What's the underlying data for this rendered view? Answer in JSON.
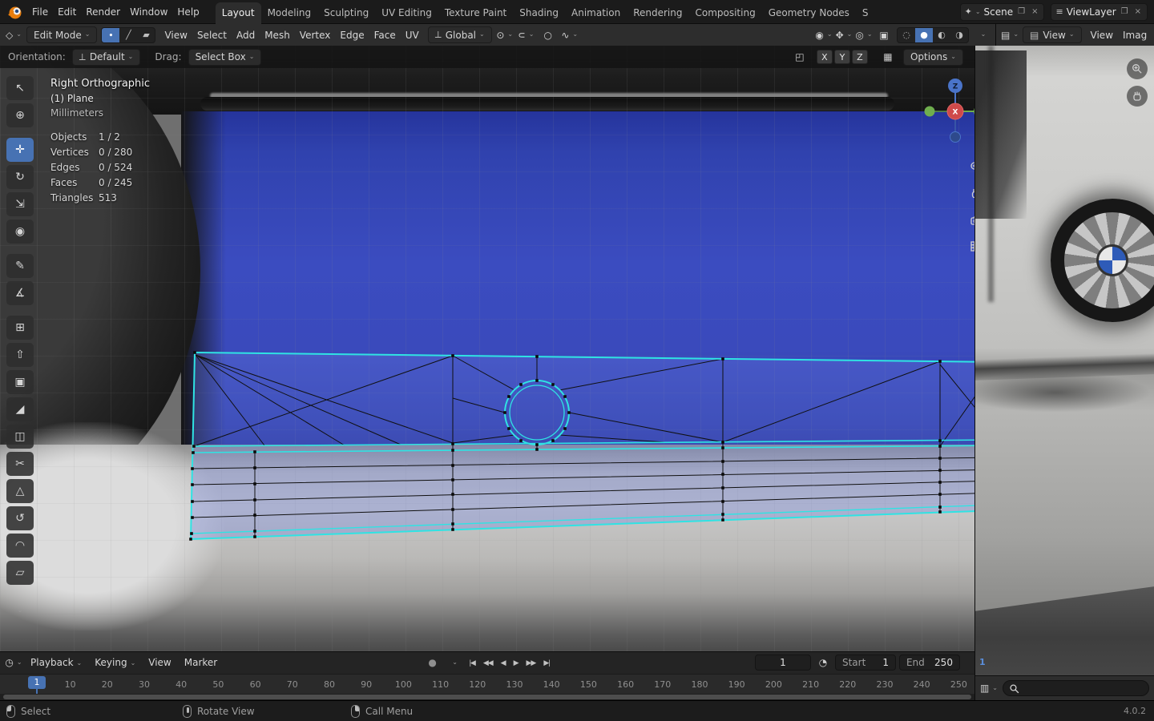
{
  "topbar": {
    "menus": [
      "File",
      "Edit",
      "Render",
      "Window",
      "Help"
    ],
    "workspaces": [
      {
        "label": "Layout",
        "active": true
      },
      {
        "label": "Modeling"
      },
      {
        "label": "Sculpting"
      },
      {
        "label": "UV Editing"
      },
      {
        "label": "Texture Paint"
      },
      {
        "label": "Shading"
      },
      {
        "label": "Animation"
      },
      {
        "label": "Rendering"
      },
      {
        "label": "Compositing"
      },
      {
        "label": "Geometry Nodes"
      },
      {
        "label": "S"
      }
    ],
    "scene_label": "Scene",
    "view_layer_label": "ViewLayer"
  },
  "viewport_header": {
    "mode": "Edit Mode",
    "select_modes": [
      {
        "name": "vertex-select",
        "glyph": "∙",
        "active": true
      },
      {
        "name": "edge-select",
        "glyph": "╱"
      },
      {
        "name": "face-select",
        "glyph": "▰"
      }
    ],
    "menus": [
      "View",
      "Select",
      "Add",
      "Mesh",
      "Vertex",
      "Edge",
      "Face",
      "UV"
    ],
    "orientation": "Global",
    "toggles": [
      {
        "name": "visibility",
        "glyph": "◉",
        "dd": true
      },
      {
        "name": "gizmos",
        "glyph": "✥",
        "dd": true
      },
      {
        "name": "overlays",
        "glyph": "◎",
        "dd": true
      },
      {
        "name": "xray",
        "glyph": "▣"
      }
    ],
    "shading_modes": [
      {
        "name": "wireframe",
        "glyph": "◌"
      },
      {
        "name": "solid",
        "glyph": "●",
        "active": true
      },
      {
        "name": "material-preview",
        "glyph": "◐"
      },
      {
        "name": "rendered",
        "glyph": "◑"
      }
    ]
  },
  "image_header": {
    "mode": "View",
    "menus": [
      "View",
      "Imag"
    ]
  },
  "tool_settings": {
    "orientation_label": "Orientation:",
    "orientation_value": "Default",
    "drag_label": "Drag:",
    "drag_value": "Select Box",
    "axes": [
      "X",
      "Y",
      "Z"
    ],
    "options_label": "Options"
  },
  "toolbar": {
    "tools": [
      {
        "name": "tweak-select",
        "glyph": "↖"
      },
      {
        "name": "cursor",
        "glyph": "⊕"
      },
      {
        "name": "move",
        "glyph": "✛",
        "active": true,
        "gap": true
      },
      {
        "name": "rotate",
        "glyph": "↻"
      },
      {
        "name": "scale",
        "glyph": "⇲"
      },
      {
        "name": "transform",
        "glyph": "◉"
      },
      {
        "name": "annotate",
        "glyph": "✎",
        "gap": true
      },
      {
        "name": "measure",
        "glyph": "∡"
      },
      {
        "name": "add-cube",
        "glyph": "⊞",
        "gap": true
      },
      {
        "name": "extrude-region",
        "glyph": "⇧"
      },
      {
        "name": "inset-faces",
        "glyph": "▣"
      },
      {
        "name": "bevel",
        "glyph": "◢"
      },
      {
        "name": "loop-cut",
        "glyph": "◫"
      },
      {
        "name": "knife",
        "glyph": "✂"
      },
      {
        "name": "poly-build",
        "glyph": "△"
      },
      {
        "name": "spin",
        "glyph": "↺"
      },
      {
        "name": "smooth",
        "glyph": "◠"
      },
      {
        "name": "edge-slide",
        "glyph": "▱"
      }
    ]
  },
  "viewport": {
    "view_label": "Right Orthographic",
    "object_label": "(1) Plane",
    "units_label": "Millimeters",
    "stats": [
      {
        "label": "Objects",
        "value": "1 / 2"
      },
      {
        "label": "Vertices",
        "value": "0 / 280"
      },
      {
        "label": "Edges",
        "value": "0 / 524"
      },
      {
        "label": "Faces",
        "value": "0 / 245"
      },
      {
        "label": "Triangles",
        "value": "513"
      }
    ],
    "gizmo": {
      "x": "X",
      "y": "Y",
      "z": "Z"
    }
  },
  "timeline": {
    "menus": [
      "Playback",
      "Keying",
      "View",
      "Marker"
    ],
    "transport": [
      {
        "name": "jump-to-start",
        "glyph": "|◀"
      },
      {
        "name": "prev-keyframe",
        "glyph": "◀◀"
      },
      {
        "name": "play-reverse",
        "glyph": "◀"
      },
      {
        "name": "play",
        "glyph": "▶"
      },
      {
        "name": "next-keyframe",
        "glyph": "▶▶"
      },
      {
        "name": "jump-to-end",
        "glyph": "▶|"
      }
    ],
    "current_frame": "1",
    "playhead_frame": "1",
    "start_label": "Start",
    "start_value": "1",
    "end_label": "End",
    "end_value": "250",
    "ruler": [
      "1",
      "10",
      "20",
      "30",
      "40",
      "50",
      "60",
      "70",
      "80",
      "90",
      "100",
      "110",
      "120",
      "130",
      "140",
      "150",
      "160",
      "170",
      "180",
      "190",
      "200",
      "210",
      "220",
      "230",
      "240",
      "250"
    ]
  },
  "image_editor": {
    "frame_indicator": "1",
    "search_value": ""
  },
  "statusbar": {
    "hints": [
      {
        "label": "Select"
      },
      {
        "label": "Rotate View"
      },
      {
        "label": "Call Menu"
      }
    ],
    "version": "4.0.2"
  },
  "icons": {
    "editor_3d": "◇",
    "editor_image": "▤",
    "editor_outliner": "▥",
    "editor_timeline": "◷",
    "scene": "✦",
    "layers": "≡",
    "new": "❐",
    "close": "×",
    "pivot": "⊙",
    "snap_magnet": "∪",
    "prop_edit": "○",
    "falloff": "∿",
    "orientation_axis": "⟂",
    "mirror": "◰",
    "snap_grid": "▦",
    "record": "●",
    "stopwatch": "◔"
  },
  "colors": {
    "accent_blue": "#4772b3",
    "edge_select_cyan": "#2fe3e3",
    "axis_x_red": "#cf4a4a",
    "axis_y_green": "#6fae4e",
    "axis_z_blue": "#4a74c9"
  }
}
